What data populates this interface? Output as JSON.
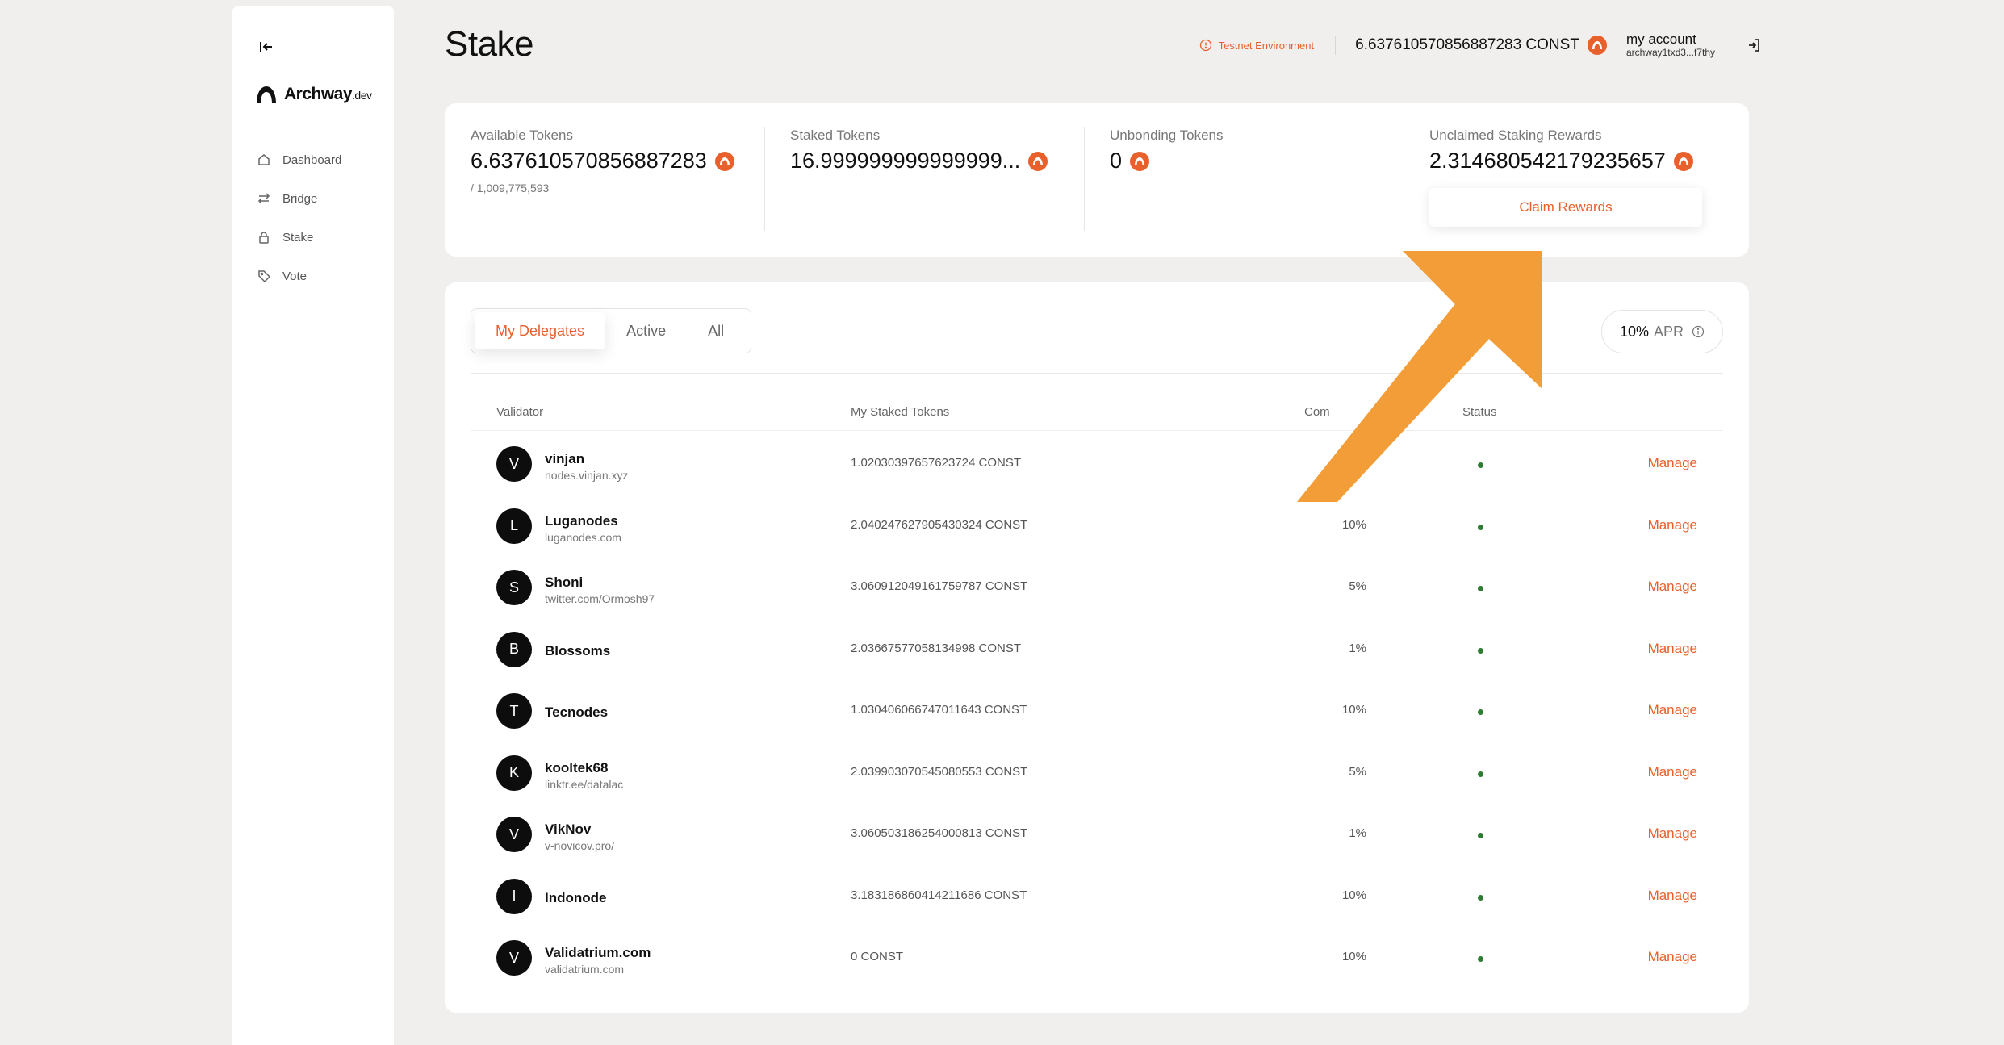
{
  "sidebar": {
    "brand": {
      "name": "Archway",
      "suffix": ".dev"
    },
    "items": [
      {
        "label": "Dashboard",
        "icon": "home-icon"
      },
      {
        "label": "Bridge",
        "icon": "arrows-swap-icon"
      },
      {
        "label": "Stake",
        "icon": "lock-icon"
      },
      {
        "label": "Vote",
        "icon": "tag-icon"
      }
    ]
  },
  "header": {
    "title": "Stake",
    "testnet_label": "Testnet Environment",
    "balance": "6.637610570856887283 CONST",
    "account_name": "my account",
    "account_address": "archway1txd3...f7thy"
  },
  "tokens": {
    "available": {
      "label": "Available Tokens",
      "value": "6.637610570856887283",
      "sub": "/ 1,009,775,593"
    },
    "staked": {
      "label": "Staked Tokens",
      "value": "16.999999999999999..."
    },
    "unbonding": {
      "label": "Unbonding Tokens",
      "value": "0"
    },
    "rewards": {
      "label": "Unclaimed Staking Rewards",
      "value": "2.314680542179235657",
      "button": "Claim Rewards"
    }
  },
  "validators": {
    "tabs": [
      "My Delegates",
      "Active",
      "All"
    ],
    "active_tab": "My Delegates",
    "apr_value": "10%",
    "apr_label": "APR",
    "columns": {
      "validator": "Validator",
      "staked": "My Staked Tokens",
      "commission": "Com",
      "status": "Status"
    },
    "rows": [
      {
        "initial": "V",
        "name": "vinjan",
        "sub": "nodes.vinjan.xyz",
        "staked": "1.02030397657623724 CONST",
        "commission": "",
        "action": "Manage"
      },
      {
        "initial": "L",
        "name": "Luganodes",
        "sub": "luganodes.com",
        "staked": "2.040247627905430324 CONST",
        "commission": "10%",
        "action": "Manage"
      },
      {
        "initial": "S",
        "name": "Shoni",
        "sub": "twitter.com/Ormosh97",
        "staked": "3.060912049161759787 CONST",
        "commission": "5%",
        "action": "Manage"
      },
      {
        "initial": "B",
        "name": "Blossoms",
        "sub": "",
        "staked": "2.03667577058134998 CONST",
        "commission": "1%",
        "action": "Manage"
      },
      {
        "initial": "T",
        "name": "Tecnodes",
        "sub": "",
        "staked": "1.030406066747011643 CONST",
        "commission": "10%",
        "action": "Manage"
      },
      {
        "initial": "K",
        "name": "kooltek68",
        "sub": "linktr.ee/datalac",
        "staked": "2.039903070545080553 CONST",
        "commission": "5%",
        "action": "Manage"
      },
      {
        "initial": "V",
        "name": "VikNov",
        "sub": "v-novicov.pro/",
        "staked": "3.060503186254000813 CONST",
        "commission": "1%",
        "action": "Manage"
      },
      {
        "initial": "I",
        "name": "Indonode",
        "sub": "",
        "staked": "3.183186860414211686 CONST",
        "commission": "10%",
        "action": "Manage"
      },
      {
        "initial": "V",
        "name": "Validatrium.com",
        "sub": "validatrium.com",
        "staked": "0 CONST",
        "commission": "10%",
        "action": "Manage"
      }
    ]
  },
  "colors": {
    "accent": "#e8602c",
    "status_active": "#2e7d32",
    "annotation_arrow": "#f29d38"
  }
}
